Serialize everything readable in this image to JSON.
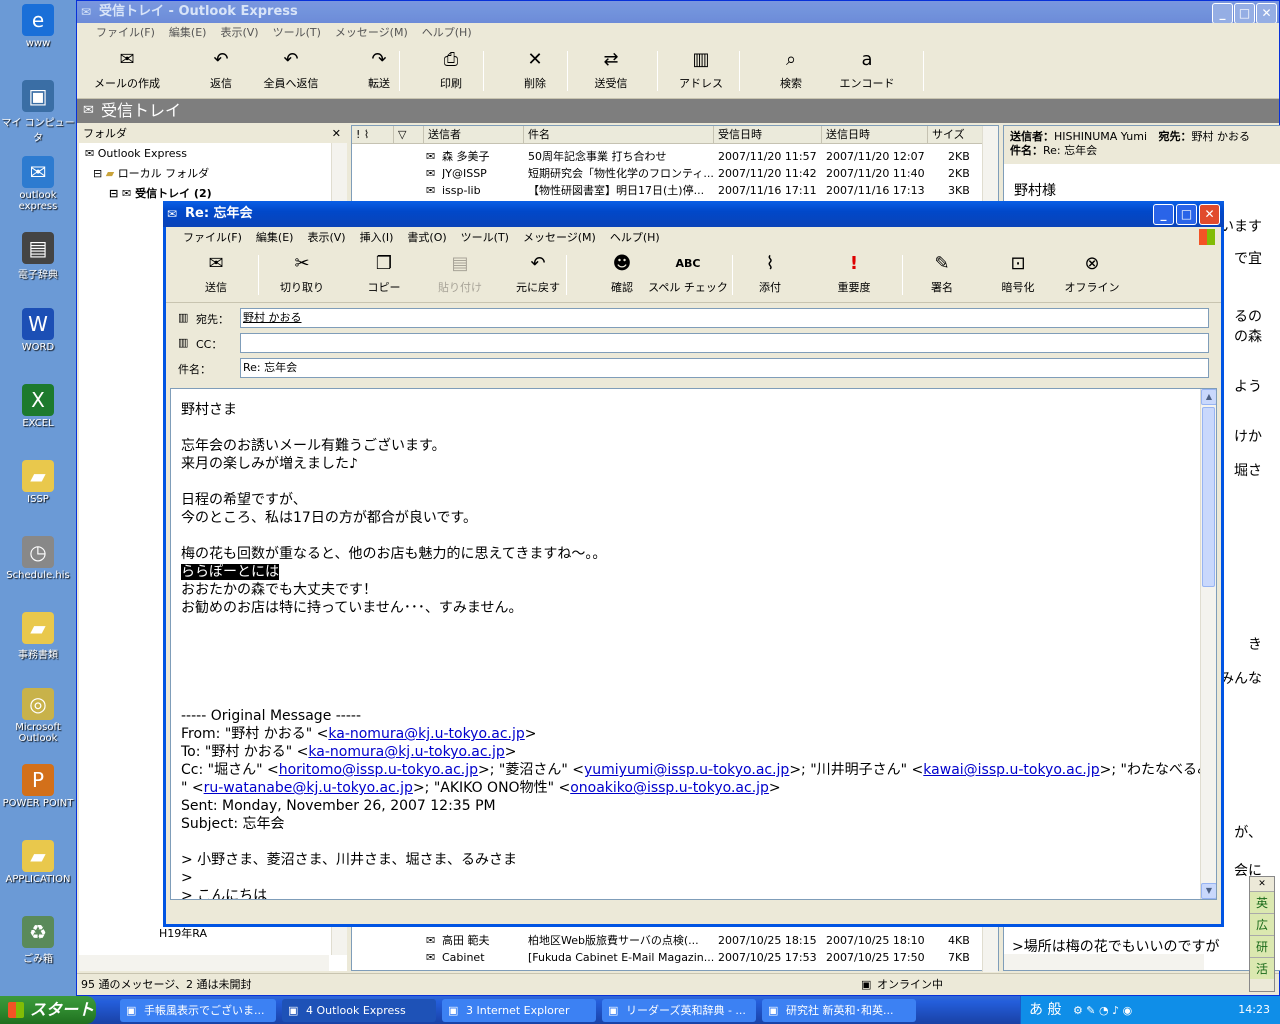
{
  "desktop_icons": [
    {
      "label": "www",
      "icon": "ie-icon",
      "glyph": "e",
      "color": "#1a6fd8"
    },
    {
      "label": "マイ コンピュータ",
      "icon": "my-computer-icon",
      "glyph": "▣",
      "color": "#3a6ea5"
    },
    {
      "label": "outlook express",
      "icon": "outlook-express-icon",
      "glyph": "✉",
      "color": "#2d7bd0"
    },
    {
      "label": "電子辞典",
      "icon": "dictionary-icon",
      "glyph": "▤",
      "color": "#444"
    },
    {
      "label": "WORD",
      "icon": "word-icon",
      "glyph": "W",
      "color": "#1c4fb5"
    },
    {
      "label": "EXCEL",
      "icon": "excel-icon",
      "glyph": "X",
      "color": "#1d7a2e"
    },
    {
      "label": "ISSP",
      "icon": "folder-icon",
      "glyph": "▰",
      "color": "#e9c84c"
    },
    {
      "label": "Schedule.his",
      "icon": "schedule-icon",
      "glyph": "◷",
      "color": "#888"
    },
    {
      "label": "事務書類",
      "icon": "folder-icon",
      "glyph": "▰",
      "color": "#e9c84c"
    },
    {
      "label": "Microsoft Outlook",
      "icon": "ms-outlook-icon",
      "glyph": "◎",
      "color": "#c8b24a"
    },
    {
      "label": "POWER POINT",
      "icon": "powerpoint-icon",
      "glyph": "P",
      "color": "#d3701a"
    },
    {
      "label": "APPLICATION",
      "icon": "folder-icon",
      "glyph": "▰",
      "color": "#e9c84c"
    },
    {
      "label": "ごみ箱",
      "icon": "recycle-bin-icon",
      "glyph": "♻",
      "color": "#5a8a5a"
    }
  ],
  "main": {
    "title": "受信トレイ - Outlook Express",
    "menu": [
      "ファイル(F)",
      "編集(E)",
      "表示(V)",
      "ツール(T)",
      "メッセージ(M)",
      "ヘルプ(H)"
    ],
    "toolbar": [
      {
        "label": "メールの作成",
        "icon": "new-mail-icon",
        "glyph": "✉"
      },
      {
        "label": "返信",
        "icon": "reply-icon",
        "glyph": "↶"
      },
      {
        "label": "全員へ返信",
        "icon": "reply-all-icon",
        "glyph": "↶"
      },
      {
        "label": "転送",
        "icon": "forward-icon",
        "glyph": "↷"
      },
      {
        "label": "印刷",
        "icon": "print-icon",
        "glyph": "⎙"
      },
      {
        "label": "削除",
        "icon": "delete-icon",
        "glyph": "✕"
      },
      {
        "label": "送受信",
        "icon": "send-receive-icon",
        "glyph": "⇄"
      },
      {
        "label": "アドレス",
        "icon": "address-book-icon",
        "glyph": "▥"
      },
      {
        "label": "検索",
        "icon": "find-icon",
        "glyph": "⌕"
      },
      {
        "label": "エンコード",
        "icon": "encode-icon",
        "glyph": "a"
      }
    ],
    "folder_header": "受信トレイ",
    "folder_pane_title": "フォルダ",
    "folders": [
      "Outlook Express",
      "ローカル フォルダ",
      "受信トレイ (2)"
    ],
    "folder_bottom": "H19年RA",
    "columns": [
      "送信者",
      "件名",
      "受信日時",
      "送信日時",
      "サイズ"
    ],
    "messages_top": [
      {
        "from": "森 多美子",
        "subject": "50周年記念事業 打ち合わせ",
        "received": "2007/11/20 11:57",
        "sent": "2007/11/20 12:07",
        "size": "2KB"
      },
      {
        "from": "JY@ISSP",
        "subject": "短期研究会「物性化学のフロンティ...",
        "received": "2007/11/20 11:42",
        "sent": "2007/11/20 11:40",
        "size": "2KB"
      },
      {
        "from": "issp-lib",
        "subject": "【物性研図書室】明日17日(土)停...",
        "received": "2007/11/16 17:11",
        "sent": "2007/11/16 17:13",
        "size": "3KB"
      }
    ],
    "messages_bottom": [
      {
        "from": "高田 範夫",
        "subject": "柏地区Web版旅費サーバの点検(...",
        "received": "2007/10/25 18:15",
        "sent": "2007/10/25 18:10",
        "size": "4KB"
      },
      {
        "from": "Cabinet",
        "subject": "[Fukuda Cabinet E-Mail Magazin...",
        "received": "2007/10/25 17:53",
        "sent": "2007/10/25 17:50",
        "size": "7KB"
      }
    ],
    "preview_from_label": "送信者：",
    "preview_from": "HISHINUMA Yumi",
    "preview_to_label": "宛先：",
    "preview_to": "野村 かおる",
    "preview_subject_label": "件名：",
    "preview_subject": "Re: 忘年会",
    "preview_greeting": "野村様",
    "preview_snippets": [
      "います",
      "で宜",
      "るの",
      "の森",
      "よう",
      "けか",
      "堀さ",
      "き",
      "みんな",
      "が、",
      "会に"
    ],
    "preview_last_line": ">場所は梅の花でもいいのですが",
    "status_left": "95 通のメッセージ、2 通は未開封",
    "status_right": "オンライン中"
  },
  "compose": {
    "title": "Re: 忘年会",
    "menu": [
      "ファイル(F)",
      "編集(E)",
      "表示(V)",
      "挿入(I)",
      "書式(O)",
      "ツール(T)",
      "メッセージ(M)",
      "ヘルプ(H)"
    ],
    "toolbar": [
      {
        "label": "送信",
        "icon": "send-icon",
        "glyph": "✉",
        "disabled": false
      },
      {
        "label": "切り取り",
        "icon": "cut-icon",
        "glyph": "✂",
        "disabled": false
      },
      {
        "label": "コピー",
        "icon": "copy-icon",
        "glyph": "❐",
        "disabled": false
      },
      {
        "label": "貼り付け",
        "icon": "paste-icon",
        "glyph": "▤",
        "disabled": true
      },
      {
        "label": "元に戻す",
        "icon": "undo-icon",
        "glyph": "↶",
        "disabled": false
      },
      {
        "label": "確認",
        "icon": "check-names-icon",
        "glyph": "☻",
        "disabled": false
      },
      {
        "label": "スペル チェック",
        "icon": "spell-check-icon",
        "glyph": "ABC",
        "disabled": false
      },
      {
        "label": "添付",
        "icon": "attach-icon",
        "glyph": "⌇",
        "disabled": false
      },
      {
        "label": "重要度",
        "icon": "priority-icon",
        "glyph": "!",
        "disabled": false
      },
      {
        "label": "署名",
        "icon": "sign-icon",
        "glyph": "✎",
        "disabled": false
      },
      {
        "label": "暗号化",
        "icon": "encrypt-icon",
        "glyph": "⊡",
        "disabled": false
      },
      {
        "label": "オフライン",
        "icon": "offline-icon",
        "glyph": "⊗",
        "disabled": false
      }
    ],
    "to_label": "宛先：",
    "to_value": "野村 かおる",
    "cc_label": "CC：",
    "cc_value": "",
    "subject_label": "件名：",
    "subject_value": "Re: 忘年会",
    "body_lines": [
      "野村さま",
      "",
      "忘年会のお誘いメール有難うございます。",
      "来月の楽しみが増えました♪",
      "",
      "日程の希望ですが、",
      "今のところ、私は17日の方が都合が良いです。",
      "",
      "梅の花も回数が重なると、他のお店も魅力的に思えてきますね～。。"
    ],
    "body_selected": "ららぽーとには",
    "body_lines_2": [
      "おおたかの森でも大丈夫です！",
      "お勧めのお店は特に持っていません･･･、すみません。"
    ],
    "orig_header": "----- Original Message -----",
    "orig_from_prefix": "From: \"野村 かおる\" <",
    "orig_from_email": "ka-nomura@kj.u-tokyo.ac.jp",
    "orig_to_prefix": "To: \"野村 かおる\" <",
    "orig_to_email": "ka-nomura@kj.u-tokyo.ac.jp",
    "orig_cc_1": "Cc: \"堀さん\" <",
    "orig_cc_email_1": "horitomo@issp.u-tokyo.ac.jp",
    "orig_cc_2": ">; \"菱沼さん\" <",
    "orig_cc_email_2": "yumiyumi@issp.u-tokyo.ac.jp",
    "orig_cc_3": ">; \"川井明子さん\" <",
    "orig_cc_email_3": "kawai@issp.u-tokyo.ac.jp",
    "orig_cc_4": ">; \"わたなべるみさ",
    "orig_cc_5": "\" <",
    "orig_cc_email_4": "ru-watanabe@kj.u-tokyo.ac.jp",
    "orig_cc_6": ">; \"AKIKO ONO物性\" <",
    "orig_cc_email_5": "onoakiko@issp.u-tokyo.ac.jp",
    "orig_sent": "Sent: Monday, November 26, 2007 12:35 PM",
    "orig_subject": "Subject: 忘年会",
    "quote_1": "> 小野さま、菱沼さま、川井さま、堀さま、るみさま",
    "quote_2": ">",
    "quote_3": "> こんにちは"
  },
  "taskbar": {
    "start": "スタート",
    "tasks": [
      "手帳風表示でございま...",
      "4 Outlook Express",
      "3 Internet Explorer",
      "リーダーズ英和辞典 - ...",
      "研究社 新英和･和英..."
    ],
    "clock": "14:23",
    "ime": "あ 般"
  },
  "ime_bar": [
    "英",
    "広",
    "研",
    "活"
  ]
}
